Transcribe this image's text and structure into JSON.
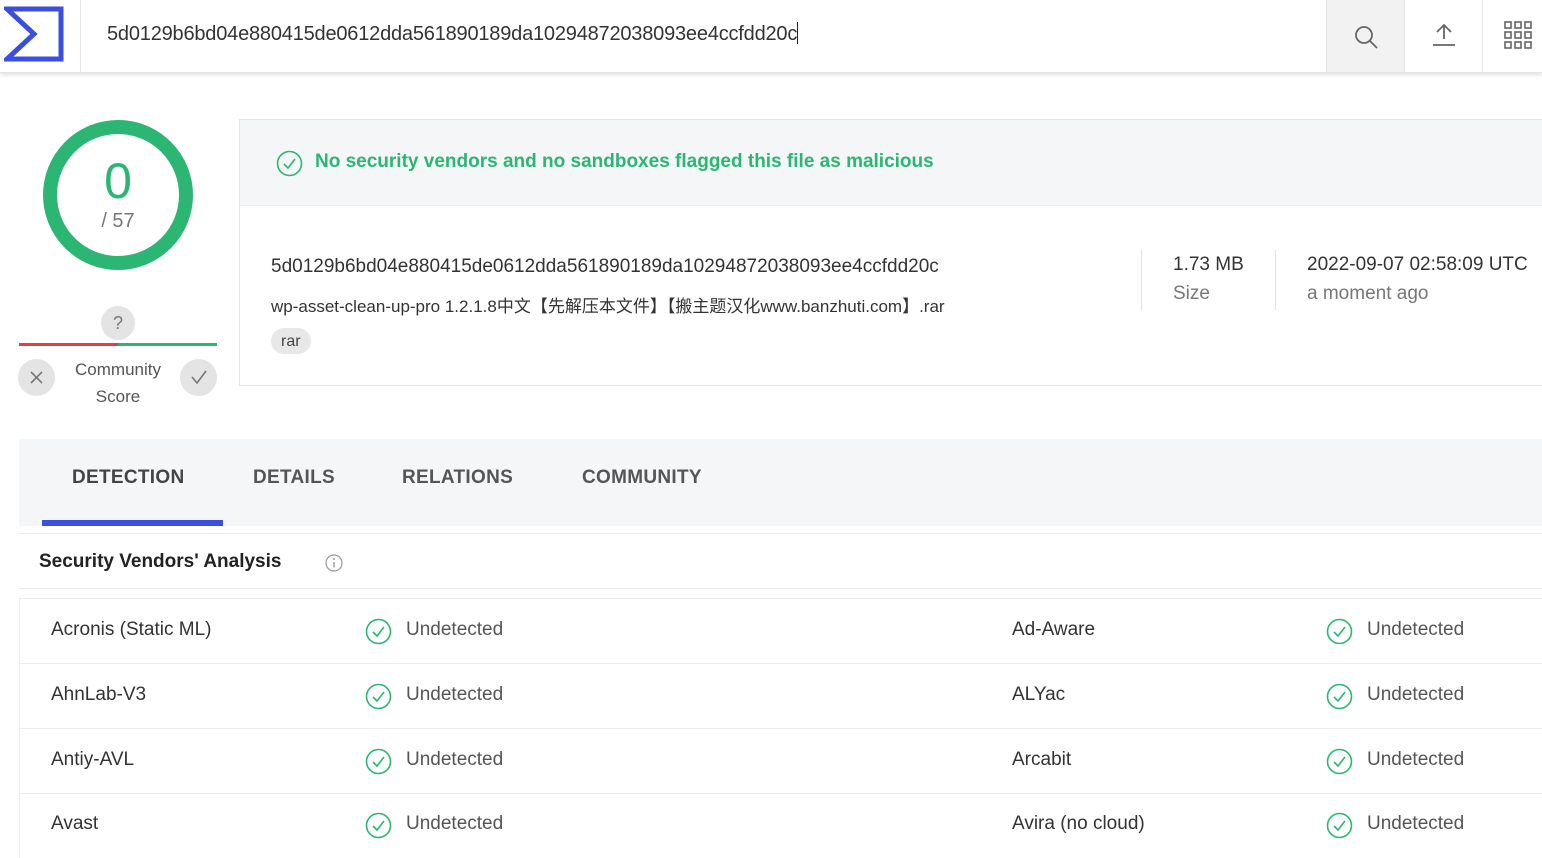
{
  "topbar": {
    "logo_icon": "virustotal-sigma-logo",
    "search_value": "5d0129b6bd04e880415de0612dda561890189da10294872038093ee4ccfdd20c",
    "buttons": [
      "search-icon",
      "upload-icon",
      "apps-grid-icon"
    ]
  },
  "score": {
    "detections": "0",
    "total": "/ 57",
    "community_help": "?",
    "community_label_1": "Community",
    "community_label_2": "Score"
  },
  "summary": {
    "banner": "No security vendors and no sandboxes flagged this file as malicious",
    "hash": "5d0129b6bd04e880415de0612dda561890189da10294872038093ee4ccfdd20c",
    "filename": "wp-asset-clean-up-pro 1.2.1.8中文【先解压本文件】【搬主题汉化www.banzhuti.com】.rar",
    "tag": "rar",
    "size_value": "1.73 MB",
    "size_label": "Size",
    "date_value": "2022-09-07 02:58:09 UTC",
    "date_label": "a moment ago"
  },
  "tabs": [
    "DETECTION",
    "DETAILS",
    "RELATIONS",
    "COMMUNITY"
  ],
  "section": {
    "title": "Security Vendors' Analysis"
  },
  "vendors": [
    {
      "left_name": "Acronis (Static ML)",
      "left_result": "Undetected",
      "right_name": "Ad-Aware",
      "right_result": "Undetected"
    },
    {
      "left_name": "AhnLab-V3",
      "left_result": "Undetected",
      "right_name": "ALYac",
      "right_result": "Undetected"
    },
    {
      "left_name": "Antiy-AVL",
      "left_result": "Undetected",
      "right_name": "Arcabit",
      "right_result": "Undetected"
    },
    {
      "left_name": "Avast",
      "left_result": "Undetected",
      "right_name": "Avira (no cloud)",
      "right_result": "Undetected"
    }
  ],
  "colors": {
    "accent": "#3a4fe0",
    "clean": "#2bb673",
    "malicious": "#e8394d"
  }
}
